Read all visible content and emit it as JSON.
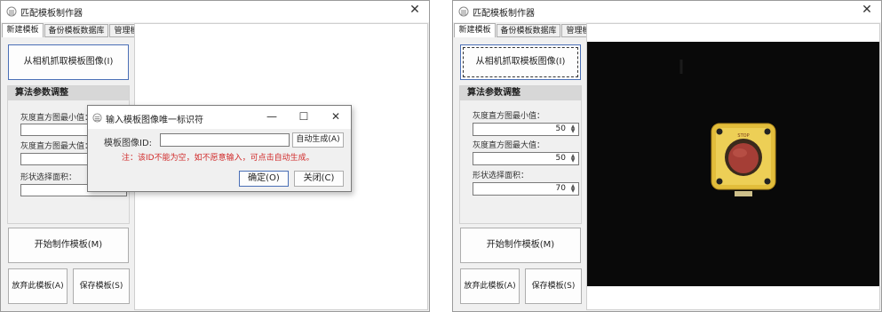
{
  "window1": {
    "title": "匹配模板制作器",
    "tabs": [
      {
        "label": "新建模板"
      },
      {
        "label": "备份模板数据库"
      },
      {
        "label": "管理模板"
      }
    ],
    "capture_button": "从相机抓取模板图像(I)",
    "group_title": "算法参数调整",
    "fields": [
      {
        "label": "灰度直方图最小值："
      },
      {
        "label": "灰度直方图最大值："
      },
      {
        "label": "形状选择面积："
      }
    ],
    "start_button": "开始制作模板(M)",
    "discard_button": "放弃此模板(A)",
    "save_button": "保存模板(S)",
    "dialog": {
      "title": "输入模板图像唯一标识符",
      "id_label": "模板图像ID:",
      "id_value": "",
      "auto_button": "自动生成(A)",
      "note": "注：该ID不能为空，如不愿意输入，可点击自动生成。",
      "ok_button": "确定(O)",
      "close_button": "关闭(C)",
      "minimize_glyph": "—",
      "maximize_glyph": "☐",
      "close_glyph": "✕"
    }
  },
  "window2": {
    "title": "匹配模板制作器",
    "tabs": [
      {
        "label": "新建模板"
      },
      {
        "label": "备份模板数据库"
      },
      {
        "label": "管理模板"
      }
    ],
    "capture_button": "从相机抓取模板图像(I)",
    "group_title": "算法参数调整",
    "fields": [
      {
        "label": "灰度直方图最小值：",
        "value": "50"
      },
      {
        "label": "灰度直方图最大值：",
        "value": "50"
      },
      {
        "label": "形状选择面积：",
        "value": "70"
      }
    ],
    "start_button": "开始制作模板(M)",
    "discard_button": "放弃此模板(A)",
    "save_button": "保存模板(S)",
    "stop_text": "STOP"
  },
  "close_glyph": "✕",
  "colors": {
    "error_red": "#d12b2b",
    "button_yellow": "#e7c43f",
    "button_red": "#a53e36",
    "image_bg": "#090909"
  }
}
